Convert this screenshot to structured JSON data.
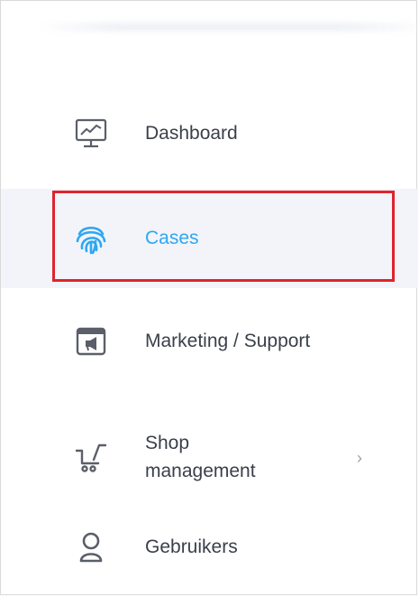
{
  "sidebar": {
    "items": [
      {
        "label": "Dashboard",
        "icon": "dashboard-monitor-icon"
      },
      {
        "label": "Cases",
        "icon": "fingerprint-icon",
        "active": true
      },
      {
        "label": "Marketing / Support",
        "icon": "megaphone-window-icon"
      },
      {
        "label": "Shop management",
        "label_line1": "Shop",
        "label_line2": "management",
        "icon": "shopping-cart-icon",
        "chevron": "›"
      },
      {
        "label": "Gebruikers",
        "icon": "user-icon"
      }
    ]
  },
  "colors": {
    "active_text": "#2ea7f2",
    "active_bg": "#f3f4fa",
    "text": "#3a3f4a",
    "highlight_border": "#e0232d"
  }
}
